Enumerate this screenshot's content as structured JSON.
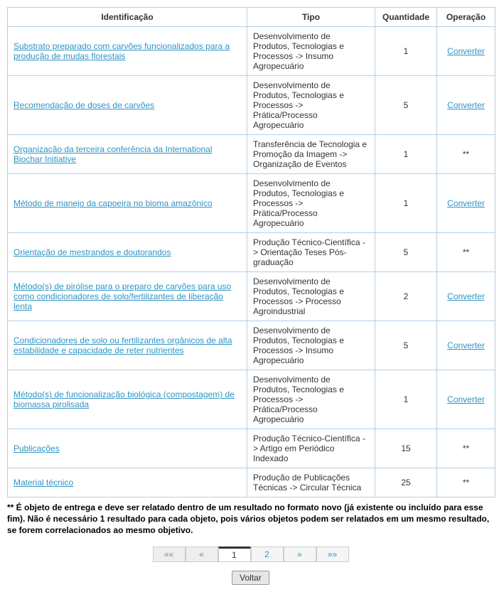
{
  "headers": {
    "id": "Identificação",
    "type": "Tipo",
    "qty": "Quantidade",
    "op": "Operação"
  },
  "rows": [
    {
      "id": "Substrato preparado com carvões funcionalizados para a produção de mudas florestais",
      "type": "Desenvolvimento de Produtos, Tecnologias e Processos -> Insumo Agropecuário",
      "qty": "1",
      "op": "Converter",
      "op_link": true
    },
    {
      "id": "Recomendação de doses de carvões",
      "type": "Desenvolvimento de Produtos, Tecnologias e Processos -> Prática/Processo Agropecuário",
      "qty": "5",
      "op": "Converter",
      "op_link": true
    },
    {
      "id": "Organização da terceira conferência da International Biochar Initiative",
      "type": "Transferência de Tecnologia e Promoção da Imagem -> Organização de Eventos",
      "qty": "1",
      "op": "**",
      "op_link": false
    },
    {
      "id": "Método de manejo da capoeira no bioma amazônico",
      "type": "Desenvolvimento de Produtos, Tecnologias e Processos -> Prática/Processo Agropecuário",
      "qty": "1",
      "op": "Converter",
      "op_link": true
    },
    {
      "id": "Orientação de mestrandos e doutorandos",
      "type": "Produção Técnico-Científica -> Orientação Teses Pós-graduação",
      "qty": "5",
      "op": "**",
      "op_link": false
    },
    {
      "id": "Método(s) de pirólise para o preparo de carvões para uso como condicionadores de solo/fertilizantes de liberação lenta",
      "type": "Desenvolvimento de Produtos, Tecnologias e Processos -> Processo Agroindustrial",
      "qty": "2",
      "op": "Converter",
      "op_link": true
    },
    {
      "id": "Condicionadores de solo ou fertilizantes orgânicos de alta estabilidade e capacidade de reter nutrientes",
      "type": "Desenvolvimento de Produtos, Tecnologias e Processos -> Insumo Agropecuário",
      "qty": "5",
      "op": "Converter",
      "op_link": true
    },
    {
      "id": "Método(s) de funcionalização biológica (compostagem) de biomassa pirolisada",
      "type": "Desenvolvimento de Produtos, Tecnologias e Processos -> Prática/Processo Agropecuário",
      "qty": "1",
      "op": "Converter",
      "op_link": true
    },
    {
      "id": "Publicações",
      "type": "Produção Técnico-Científica -> Artigo em Periódico Indexado",
      "qty": "15",
      "op": "**",
      "op_link": false
    },
    {
      "id": "Material técnico",
      "type": "Produção de Publicações Técnicas -> Circular Técnica",
      "qty": "25",
      "op": "**",
      "op_link": false
    }
  ],
  "footnote": "** É objeto de entrega e deve ser relatado dentro de um resultado no formato novo (já existente ou incluído para esse fim). Não é necessário 1 resultado para cada objeto, pois vários objetos podem ser relatados em um mesmo resultado, se forem correlacionados ao mesmo objetivo.",
  "pager": {
    "first": "««",
    "prev": "«",
    "page1": "1",
    "page2": "2",
    "next": "»",
    "last": "»»"
  },
  "back_label": "Voltar"
}
